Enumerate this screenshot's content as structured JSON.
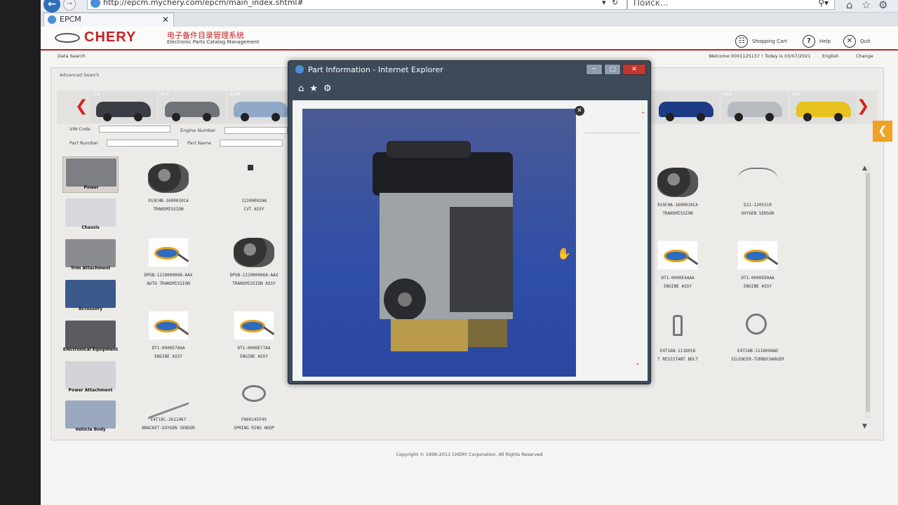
{
  "browser": {
    "url": "http://epcm.mychery.com/epcm/main_index.shtml#",
    "search_placeholder": "Поиск...",
    "tab_title": "EPCM"
  },
  "header": {
    "brand": "CHERY",
    "title_cn": "电子备件目录管理系统",
    "title_en": "Electronic Parts Catalog Management",
    "shopping_cart": "Shopping Cart",
    "help": "Help",
    "quit": "Quit"
  },
  "subnav": {
    "data_search": "Data Search",
    "welcome": "Welcome 0001125137 ! Today is 03/07/2021",
    "english": "English",
    "change": "Change"
  },
  "panel": {
    "advanced_search": "Advanced Search",
    "cars": [
      {
        "label": "T19",
        "color": "#3a3e44"
      },
      {
        "label": "A13",
        "color": "#6f7378"
      },
      {
        "label": "A13A",
        "color": "#8fa9c7"
      },
      {
        "label": "",
        "color": "#1e3c86"
      },
      {
        "label": "A14",
        "color": "#b8bcc2"
      },
      {
        "label": "A11",
        "color": "#e8c21f"
      }
    ],
    "form": {
      "vin_code": "VIN Code",
      "engine_number": "Engine Number",
      "part_number": "Part Number",
      "part_name": "Part Name"
    },
    "categories": [
      "Power",
      "Chassis",
      "Trim Attachment",
      "Accessory",
      "Electronical Equipment",
      "Power Attachment",
      "Vehicle Body"
    ],
    "parts_left": [
      {
        "code": "019CHB-1600010CA",
        "name": "TRANSMISSION"
      },
      {
        "code": "12100002AA",
        "name": "CVT ASSY"
      },
      {
        "code": "DPUB-1210000068-AAX",
        "name": "AUTO TRANSMISSION"
      },
      {
        "code": "DPUB-1210000068-AAX",
        "name": "TRANSMISSION ASSY"
      },
      {
        "code": "DT1-0000E76AA",
        "name": "ENGINE ASSY"
      },
      {
        "code": "DT1-0000E77AA",
        "name": "ENGINE ASSY"
      },
      {
        "code": "E4T18C-2611067",
        "name": "BRACKET-OXYGEN SENSOR"
      },
      {
        "code": "F060145F4S",
        "name": "SPRING RING HOOP"
      }
    ],
    "parts_right": [
      {
        "code": "019CHA-1600010CA",
        "name": "TRANSMISSION"
      },
      {
        "code": "E21-1205310",
        "name": "OXYGEN SENSOR"
      },
      {
        "code": "DT1-0000E44AA",
        "name": "ENGINE ASSY"
      },
      {
        "code": "DT1-0000E80AA",
        "name": "ENGINE ASSY"
      },
      {
        "code": "E4T16B-1118018",
        "name": "T RESISTANT BOLT"
      },
      {
        "code": "E4T16B-1118094AD",
        "name": "SILENCER-TURBOCHARGER"
      }
    ],
    "copyright": "Copyright © 1996-2011 CHERY Corporation, All Rights Reserved"
  },
  "popup": {
    "title": "Part Information - Internet Explorer"
  },
  "icons": {
    "back": "back-arrow-icon",
    "forward": "forward-arrow-icon",
    "home": "home-icon",
    "favorites": "star-icon",
    "settings": "gear-icon"
  },
  "colors": {
    "brand_red": "#c81f24",
    "accent_orange": "#f0a223",
    "engine_bg": "#2f4ea8"
  }
}
